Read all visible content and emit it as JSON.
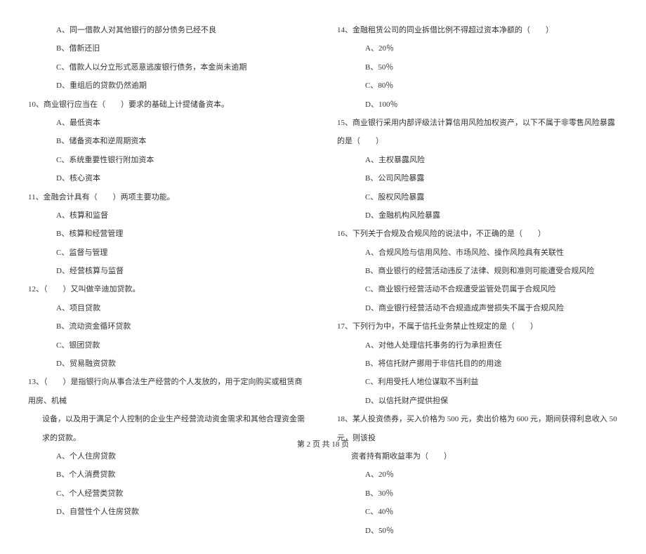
{
  "left_column": {
    "q9_options": [
      "A、同一借款人对其他银行的部分债务已经不良",
      "B、借新还旧",
      "C、借款人以分立形式恶意逃废银行债务，本金尚未逾期",
      "D、重组后的贷款仍然逾期"
    ],
    "q10": {
      "text": "10、商业银行应当在（　　）要求的基础上计提储备资本。",
      "options": [
        "A、最低资本",
        "B、储备资本和逆周期资本",
        "C、系统重要性银行附加资本",
        "D、核心资本"
      ]
    },
    "q11": {
      "text": "11、金融会计具有（　　）两项主要功能。",
      "options": [
        "A、核算和监督",
        "B、核算和经营管理",
        "C、监督与管理",
        "D、经营核算与监督"
      ]
    },
    "q12": {
      "text": "12、（　　）又叫做辛迪加贷款。",
      "options": [
        "A、项目贷款",
        "B、流动资金循环贷款",
        "C、银团贷款",
        "D、贸易融资贷款"
      ]
    },
    "q13": {
      "text": "13、（　　）是指银行向从事合法生产经营的个人发放的，用于定向购买或租赁商用房、机械",
      "text2": "设备，以及用于满足个人控制的企业生产经营流动资金需求和其他合理资金需求的贷款。",
      "options": [
        "A、个人住房贷款",
        "B、个人消费贷款",
        "C、个人经营类贷款",
        "D、自营性个人住房贷款"
      ]
    }
  },
  "right_column": {
    "q14": {
      "text": "14、金融租赁公司的同业拆借比例不得超过资本净额的（　　）",
      "options": [
        "A、20％",
        "B、50％",
        "C、80％",
        "D、100％"
      ]
    },
    "q15": {
      "text": "15、商业银行采用内部评级法计算信用风险加权资产，以下不属于非零售风险暴露的是（　　）",
      "options": [
        "A、主权暴露风险",
        "B、公司风险暴露",
        "C、股权风险暴露",
        "D、金融机构风险暴露"
      ]
    },
    "q16": {
      "text": "16、下列关于合规及合规风险的说法中，不正确的是（　　）",
      "options": [
        "A、合规风险与信用风险、市场风险、操作风险具有关联性",
        "B、商业银行的经营活动违反了法律、规则和准则可能遭受合规风险",
        "C、商业银行经营活动不合规遭受监管处罚属于合规风险",
        "D、商业银行经营活动不合规造成声誉损失不属于合规风险"
      ]
    },
    "q17": {
      "text": "17、下列行为中，不属于信托业务禁止性规定的是（　　）",
      "options": [
        "A、对他人处理信托事务的行为承担责任",
        "B、将信托财产挪用于非信托目的的用途",
        "C、利用受托人地位谋取不当利益",
        "D、以信托财产提供担保"
      ]
    },
    "q18": {
      "text": "18、某人投资债券，买入价格为 500 元，卖出价格为 600 元，期间获得利息收入 50 元，则该投",
      "text2": "资者持有期收益率为（　　）",
      "options": [
        "A、20％",
        "B、30％",
        "C、40％",
        "D、50％"
      ]
    }
  },
  "footer": "第 2 页 共 18 页"
}
